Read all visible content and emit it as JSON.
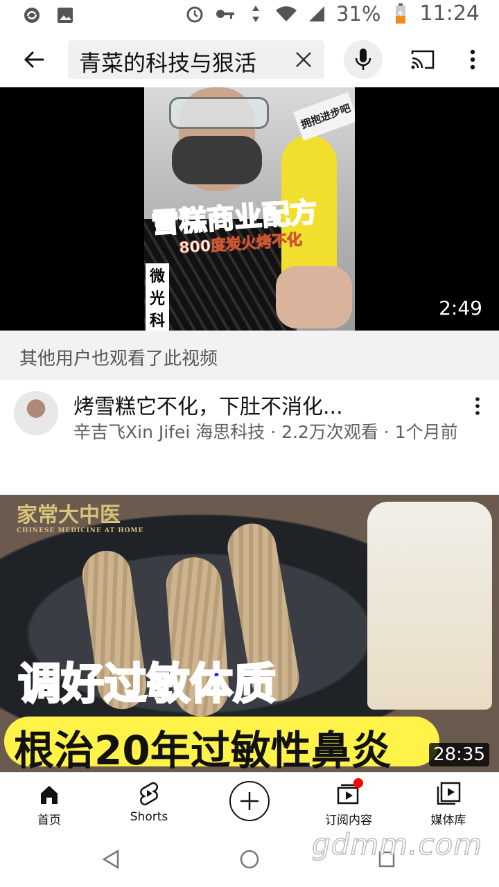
{
  "status_bar": {
    "battery": "31%",
    "time": "11:24",
    "icons": [
      "sync-icon",
      "image-icon",
      "alarm-icon",
      "key-icon",
      "data-arrows-icon",
      "wifi-icon",
      "signal-icon",
      "battery-charging-icon"
    ]
  },
  "search": {
    "query": "青菜的科技与狠活"
  },
  "video1": {
    "duration": "2:49",
    "thumb_tag": "拥抱进步吧",
    "thumb_title": "雪糕商业配方",
    "thumb_subtitle": "800度炭火烤不化",
    "thumb_side": "微光科技"
  },
  "section": {
    "also_watched": "其他用户也观看了此视频"
  },
  "item": {
    "title": "烤雪糕它不化，下肚不消化...",
    "meta": "辛吉飞Xin Jifei 海思科技 · 2.2万次观看 · 1个月前"
  },
  "video2": {
    "duration": "28:35",
    "logo": "家常大中医",
    "logo_en": "CHINESE MEDICINE AT HOME",
    "title_a": "调好过敏体质",
    "title_b": "根治20年过敏性鼻炎"
  },
  "bottom_nav": {
    "home": "首页",
    "shorts": "Shorts",
    "subscriptions": "订阅内容",
    "library": "媒体库"
  },
  "watermark": "gdmm.com",
  "colors": {
    "notification_dot": "#ff0000",
    "thumb_title_red": "#ff4a1a",
    "thumb2_blue": "#1b2ad6",
    "thumb2_yellow": "#fff34a"
  }
}
